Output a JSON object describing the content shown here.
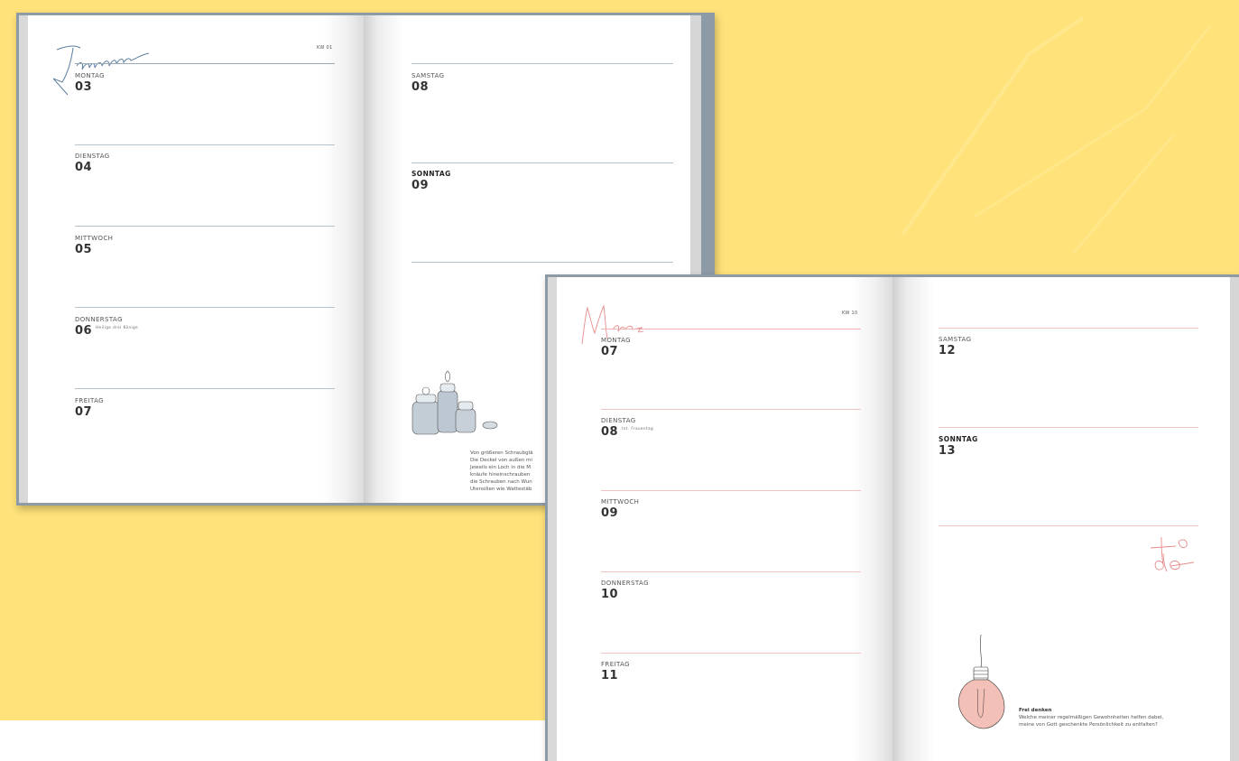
{
  "colors": {
    "background": "#ffe27a",
    "book_cover": "#8d9ba6",
    "january_accent": "#5d7fa0",
    "march_accent": "#e58b8b"
  },
  "planner_january": {
    "month_script": "Januar",
    "week": "KW 01",
    "days": [
      {
        "label": "MONTAG",
        "num": "03"
      },
      {
        "label": "DIENSTAG",
        "num": "04"
      },
      {
        "label": "MITTWOCH",
        "num": "05"
      },
      {
        "label": "DONNERSTAG",
        "num": "06",
        "note": "Heilige drei Könige"
      },
      {
        "label": "FREITAG",
        "num": "07"
      },
      {
        "label": "SAMSTAG",
        "num": "08"
      },
      {
        "label": "SONNTAG",
        "num": "09"
      }
    ],
    "caption_lines": [
      "Von größeren Schraubglä",
      "Die Deckel von außen mi",
      "Jeweils ein Loch in die M",
      "knäufe hineinschrauben",
      "die Schrauben nach Wun",
      "Utensilien wie Wattestäb"
    ],
    "illustration": "jars-illustration"
  },
  "planner_march": {
    "month_script": "März",
    "week": "KW 10",
    "days": [
      {
        "label": "MONTAG",
        "num": "07"
      },
      {
        "label": "DIENSTAG",
        "num": "08",
        "note": "Int. Frauentag"
      },
      {
        "label": "MITTWOCH",
        "num": "09"
      },
      {
        "label": "DONNERSTAG",
        "num": "10"
      },
      {
        "label": "FREITAG",
        "num": "11"
      },
      {
        "label": "SAMSTAG",
        "num": "12"
      },
      {
        "label": "SONNTAG",
        "num": "13"
      }
    ],
    "todo_script": "to do",
    "caption_title": "Frei denken",
    "caption_lines": [
      "Welche meiner regelmäßigen Gewohnheiten helfen dabei,",
      "meine von Gott geschenkte Persönlichkeit zu entfalten?"
    ],
    "illustration": "lightbulb-illustration"
  }
}
